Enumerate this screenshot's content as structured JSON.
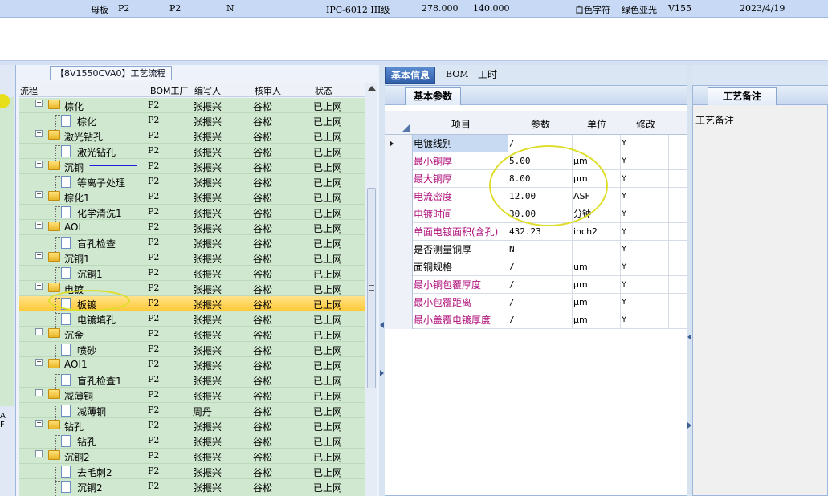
{
  "top_row": {
    "c1": "母板",
    "c2": "P2",
    "c3": "P2",
    "c4": "N",
    "c5": "IPC-6012 III级",
    "c6": "278.000",
    "c7": "140.000",
    "c8": "白色字符",
    "c9": "绿色亚光",
    "c10": "V155",
    "c11": "2023/4/19"
  },
  "sliver": {
    "letter_a": "A",
    "letter_b": "F"
  },
  "flow_panel": {
    "tab_label": "【8V1550CVA0】工艺流程",
    "headers": {
      "flow": "流程",
      "bom": "BOM工厂",
      "writer": "编写人",
      "reviewer": "核审人",
      "status": "状态"
    },
    "rows": [
      {
        "name": "棕化",
        "level": 1,
        "bom": "P2",
        "writer": "张振兴",
        "reviewer": "谷松",
        "status": "已上网"
      },
      {
        "name": "棕化",
        "level": 2,
        "bom": "P2",
        "writer": "张振兴",
        "reviewer": "谷松",
        "status": "已上网"
      },
      {
        "name": "激光钻孔",
        "level": 1,
        "bom": "P2",
        "writer": "张振兴",
        "reviewer": "谷松",
        "status": "已上网"
      },
      {
        "name": "激光钻孔",
        "level": 2,
        "bom": "P2",
        "writer": "张振兴",
        "reviewer": "谷松",
        "status": "已上网"
      },
      {
        "name": "沉铜",
        "level": 1,
        "bom": "P2",
        "writer": "张振兴",
        "reviewer": "谷松",
        "status": "已上网"
      },
      {
        "name": "等离子处理",
        "level": 2,
        "bom": "P2",
        "writer": "张振兴",
        "reviewer": "谷松",
        "status": "已上网"
      },
      {
        "name": "棕化1",
        "level": 1,
        "bom": "P2",
        "writer": "张振兴",
        "reviewer": "谷松",
        "status": "已上网"
      },
      {
        "name": "化学清洗1",
        "level": 2,
        "bom": "P2",
        "writer": "张振兴",
        "reviewer": "谷松",
        "status": "已上网"
      },
      {
        "name": "AOI",
        "level": 1,
        "bom": "P2",
        "writer": "张振兴",
        "reviewer": "谷松",
        "status": "已上网"
      },
      {
        "name": "盲孔检查",
        "level": 2,
        "bom": "P2",
        "writer": "张振兴",
        "reviewer": "谷松",
        "status": "已上网"
      },
      {
        "name": "沉铜1",
        "level": 1,
        "bom": "P2",
        "writer": "张振兴",
        "reviewer": "谷松",
        "status": "已上网"
      },
      {
        "name": "沉铜1",
        "level": 2,
        "bom": "P2",
        "writer": "张振兴",
        "reviewer": "谷松",
        "status": "已上网"
      },
      {
        "name": "电镀",
        "level": 1,
        "bom": "P2",
        "writer": "张振兴",
        "reviewer": "谷松",
        "status": "已上网"
      },
      {
        "name": "板镀",
        "level": 2,
        "bom": "P2",
        "writer": "张振兴",
        "reviewer": "谷松",
        "status": "已上网",
        "selected": true
      },
      {
        "name": "电镀填孔",
        "level": 2,
        "bom": "P2",
        "writer": "张振兴",
        "reviewer": "谷松",
        "status": "已上网"
      },
      {
        "name": "沉金",
        "level": 1,
        "bom": "P2",
        "writer": "张振兴",
        "reviewer": "谷松",
        "status": "已上网"
      },
      {
        "name": "喷砂",
        "level": 2,
        "bom": "P2",
        "writer": "张振兴",
        "reviewer": "谷松",
        "status": "已上网"
      },
      {
        "name": "AOI1",
        "level": 1,
        "bom": "P2",
        "writer": "张振兴",
        "reviewer": "谷松",
        "status": "已上网"
      },
      {
        "name": "盲孔检查1",
        "level": 2,
        "bom": "P2",
        "writer": "张振兴",
        "reviewer": "谷松",
        "status": "已上网"
      },
      {
        "name": "减薄铜",
        "level": 1,
        "bom": "P2",
        "writer": "张振兴",
        "reviewer": "谷松",
        "status": "已上网"
      },
      {
        "name": "减薄铜",
        "level": 2,
        "bom": "P2",
        "writer": "周丹",
        "reviewer": "谷松",
        "status": "已上网"
      },
      {
        "name": "钻孔",
        "level": 1,
        "bom": "P2",
        "writer": "张振兴",
        "reviewer": "谷松",
        "status": "已上网"
      },
      {
        "name": "钻孔",
        "level": 2,
        "bom": "P2",
        "writer": "张振兴",
        "reviewer": "谷松",
        "status": "已上网"
      },
      {
        "name": "沉铜2",
        "level": 1,
        "bom": "P2",
        "writer": "张振兴",
        "reviewer": "谷松",
        "status": "已上网"
      },
      {
        "name": "去毛刺2",
        "level": 2,
        "bom": "P2",
        "writer": "张振兴",
        "reviewer": "谷松",
        "status": "已上网"
      },
      {
        "name": "沉铜2",
        "level": 2,
        "bom": "P2",
        "writer": "张振兴",
        "reviewer": "谷松",
        "status": "已上网"
      }
    ]
  },
  "tabs": {
    "basic": "基本信息",
    "bom": "BOM",
    "hours": "工时"
  },
  "param_panel": {
    "tab_label": "基本参数",
    "headers": {
      "item": "项目",
      "param": "参数",
      "unit": "单位",
      "modify": "修改"
    },
    "rows": [
      {
        "item": "电镀线别",
        "value": "/",
        "unit": "",
        "modify": "Y",
        "color": "#000000",
        "current": true
      },
      {
        "item": "最小铜厚",
        "value": "5.00",
        "unit": "μm",
        "modify": "Y",
        "color": "#b0127c"
      },
      {
        "item": "最大铜厚",
        "value": "8.00",
        "unit": "μm",
        "modify": "Y",
        "color": "#b0127c"
      },
      {
        "item": "电流密度",
        "value": "12.00",
        "unit": "ASF",
        "modify": "Y",
        "color": "#b0127c"
      },
      {
        "item": "电镀时间",
        "value": "30.00",
        "unit": "分钟",
        "modify": "Y",
        "color": "#b0127c"
      },
      {
        "item": "单面电镀面积(含孔)",
        "value": "432.23",
        "unit": "inch2",
        "modify": "Y",
        "color": "#b0127c"
      },
      {
        "item": "是否测量铜厚",
        "value": "N",
        "unit": "",
        "modify": "Y",
        "color": "#000000"
      },
      {
        "item": "面铜规格",
        "value": "/",
        "unit": "um",
        "modify": "Y",
        "color": "#000000"
      },
      {
        "item": "最小铜包覆厚度",
        "value": "/",
        "unit": "μm",
        "modify": "Y",
        "color": "#b0127c"
      },
      {
        "item": "最小包覆距离",
        "value": "/",
        "unit": "μm",
        "modify": "Y",
        "color": "#b0127c"
      },
      {
        "item": "最小盖覆电镀厚度",
        "value": "/",
        "unit": "μm",
        "modify": "Y",
        "color": "#b0127c"
      }
    ]
  },
  "note_panel": {
    "tab_label": "工艺备注",
    "label": "工艺备注"
  },
  "colors": {
    "tree_bg": "#cfe8cf",
    "selected": "#ffd24a",
    "magenta_text": "#b0127c",
    "active_tab": "#3a68b0"
  }
}
